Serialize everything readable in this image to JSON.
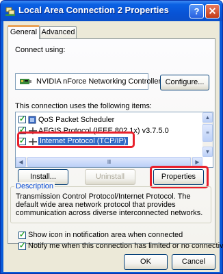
{
  "window": {
    "title": "Local Area Connection 2 Properties",
    "help_glyph": "?",
    "close_glyph": "✕"
  },
  "tabs": [
    {
      "label": "General",
      "selected": true
    },
    {
      "label": "Advanced",
      "selected": false
    }
  ],
  "connect_using": {
    "label": "Connect using:",
    "adapter": "NVIDIA nForce Networking Controller",
    "configure_label": "Configure..."
  },
  "items": {
    "label": "This connection uses the following items:",
    "list": [
      {
        "label": "QoS Packet Scheduler",
        "checked": true
      },
      {
        "label": "AEGIS Protocol (IEEE 802.1x) v3.7.5.0",
        "checked": true
      },
      {
        "label": "Internet Protocol (TCP/IP)",
        "checked": true,
        "selected": true
      }
    ]
  },
  "buttons": {
    "install": "Install...",
    "uninstall": "Uninstall",
    "properties": "Properties",
    "ok": "OK",
    "cancel": "Cancel"
  },
  "description": {
    "label": "Description",
    "text": "Transmission Control Protocol/Internet Protocol. The default wide area network protocol that provides communication across diverse interconnected networks."
  },
  "options": {
    "show_icon": {
      "label": "Show icon in notification area when connected",
      "checked": true
    },
    "notify": {
      "label": "Notify me when this connection has limited or no connectivity",
      "checked": true
    }
  },
  "colors": {
    "title_blue": "#0a5bd8",
    "highlight_red": "#e8202b",
    "selection_blue": "#316ac5"
  }
}
